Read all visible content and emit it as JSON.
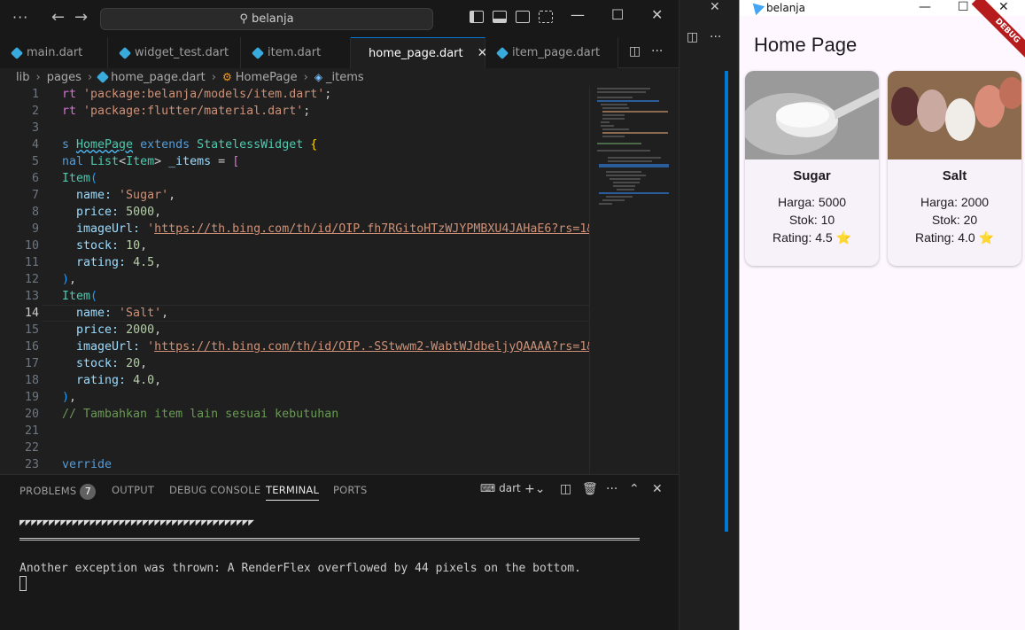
{
  "vscode": {
    "search_text": "belanja",
    "tabs": [
      "main.dart",
      "widget_test.dart",
      "item.dart",
      "home_page.dart",
      "item_page.dart"
    ],
    "breadcrumb": [
      "lib",
      "pages",
      "home_page.dart",
      "HomePage",
      "_items"
    ],
    "line_numbers": [
      "1",
      "2",
      "3",
      "4",
      "5",
      "6",
      "7",
      "8",
      "9",
      "10",
      "11",
      "12",
      "13",
      "14",
      "15",
      "16",
      "17",
      "18",
      "19",
      "20",
      "21",
      "22",
      "23"
    ],
    "code": {
      "l1a": "rt ",
      "l1b": "'package:belanja/models/item.dart'",
      "l1c": ";",
      "l2a": "rt ",
      "l2b": "'package:flutter/material.dart'",
      "l2c": ";",
      "l4a": "s ",
      "l4b": "HomePage",
      "l4c": " extends ",
      "l4d": "StatelessWidget",
      "l4e": " {",
      "l5a": "nal ",
      "l5b": "List",
      "l5c": "<",
      "l5d": "Item",
      "l5e": "> ",
      "l5f": "_items",
      "l5g": " = ",
      "l5h": "[",
      "l6a": "Item",
      "l6b": "(",
      "l7a": "  name: ",
      "l7b": "'Sugar'",
      "l7c": ",",
      "l8a": "  price: ",
      "l8b": "5000",
      "l8c": ",",
      "l9a": "  imageUrl: ",
      "l9b": "'",
      "l9c": "https://th.bing.com/th/id/OIP.fh7RGitoHTzWJYPMBXU4JAHaE6?rs=1&pid",
      "l10a": "  stock: ",
      "l10b": "10",
      "l10c": ",",
      "l11a": "  rating: ",
      "l11b": "4.5",
      "l11c": ",",
      "l12a": ")",
      "l12b": ",",
      "l13a": "Item",
      "l13b": "(",
      "l14a": "  name: ",
      "l14b": "'Salt'",
      "l14c": ",",
      "l15a": "  price: ",
      "l15b": "2000",
      "l15c": ",",
      "l16a": "  imageUrl: ",
      "l16b": "'",
      "l16c": "https://th.bing.com/th/id/OIP.-SStwwm2-WabtWJdbeljyQAAAA?rs=1&pid",
      "l17a": "  stock: ",
      "l17b": "20",
      "l17c": ",",
      "l18a": "  rating: ",
      "l18b": "4.0",
      "l18c": ",",
      "l19a": ")",
      "l19b": ",",
      "l20": "// Tambahkan item lain sesuai kebutuhan",
      "l23": "verride"
    },
    "panel": {
      "tabs": [
        "PROBLEMS",
        "OUTPUT",
        "DEBUG CONSOLE",
        "TERMINAL",
        "PORTS"
      ],
      "problems_count": "7",
      "shell": "dart",
      "term_pattern": "◤◤◤◤◤◤◤◤◤◤◤◤◤◤◤◤◤◤◤◤◤◤◤◤◤◤◤◤◤◤◤◤◤◤◤◤◤◤◤◤",
      "term_message": "Another exception was thrown: A RenderFlex overflowed by 44 pixels on the bottom."
    }
  },
  "app": {
    "window_title": "belanja",
    "appbar_title": "Home Page",
    "debug_banner": "DEBUG",
    "items": [
      {
        "name": "Sugar",
        "price": "Harga: 5000",
        "stock": "Stok: 10",
        "rating": "Rating: 4.5 ⭐"
      },
      {
        "name": "Salt",
        "price": "Harga: 2000",
        "stock": "Stok: 20",
        "rating": "Rating: 4.0 ⭐"
      }
    ]
  }
}
